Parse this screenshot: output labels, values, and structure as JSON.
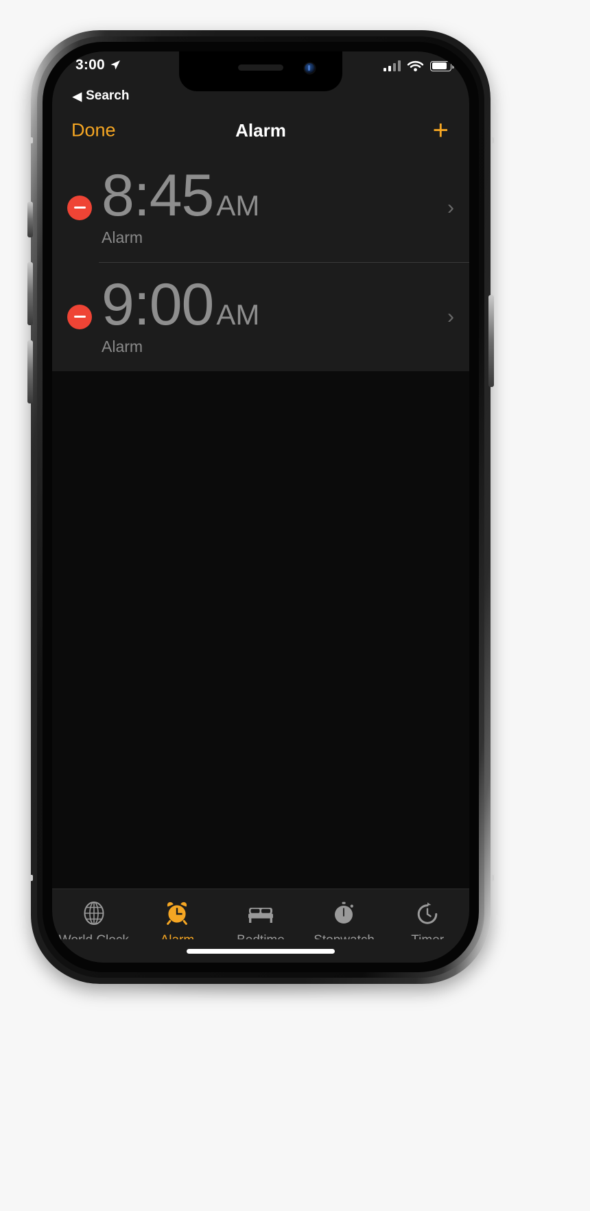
{
  "status_bar": {
    "time": "3:00",
    "location_icon": "location-arrow-icon",
    "cellular_icon": "cellular-bars-icon",
    "wifi_icon": "wifi-icon",
    "battery_icon": "battery-icon",
    "battery_level_percent": 74
  },
  "back_link": {
    "caret": "◀",
    "label": "Search"
  },
  "nav": {
    "left_button": "Done",
    "title": "Alarm",
    "right_button": "+"
  },
  "alarms": [
    {
      "time": "8:45",
      "meridiem": "AM",
      "label": "Alarm",
      "delete_icon": "minus-circle-icon",
      "chevron": "›"
    },
    {
      "time": "9:00",
      "meridiem": "AM",
      "label": "Alarm",
      "delete_icon": "minus-circle-icon",
      "chevron": "›"
    }
  ],
  "tabs": [
    {
      "label": "World Clock",
      "icon": "globe-icon",
      "active": false
    },
    {
      "label": "Alarm",
      "icon": "alarm-clock-icon",
      "active": true
    },
    {
      "label": "Bedtime",
      "icon": "bed-icon",
      "active": false
    },
    {
      "label": "Stopwatch",
      "icon": "stopwatch-icon",
      "active": false
    },
    {
      "label": "Timer",
      "icon": "timer-icon",
      "active": false
    }
  ],
  "colors": {
    "accent_orange": "#f5a623",
    "delete_red": "#ef4435",
    "bar_background": "#1c1c1c",
    "screen_background": "#000000",
    "time_text": "#8e8e8e",
    "inactive_tab": "#9a9a9a"
  }
}
